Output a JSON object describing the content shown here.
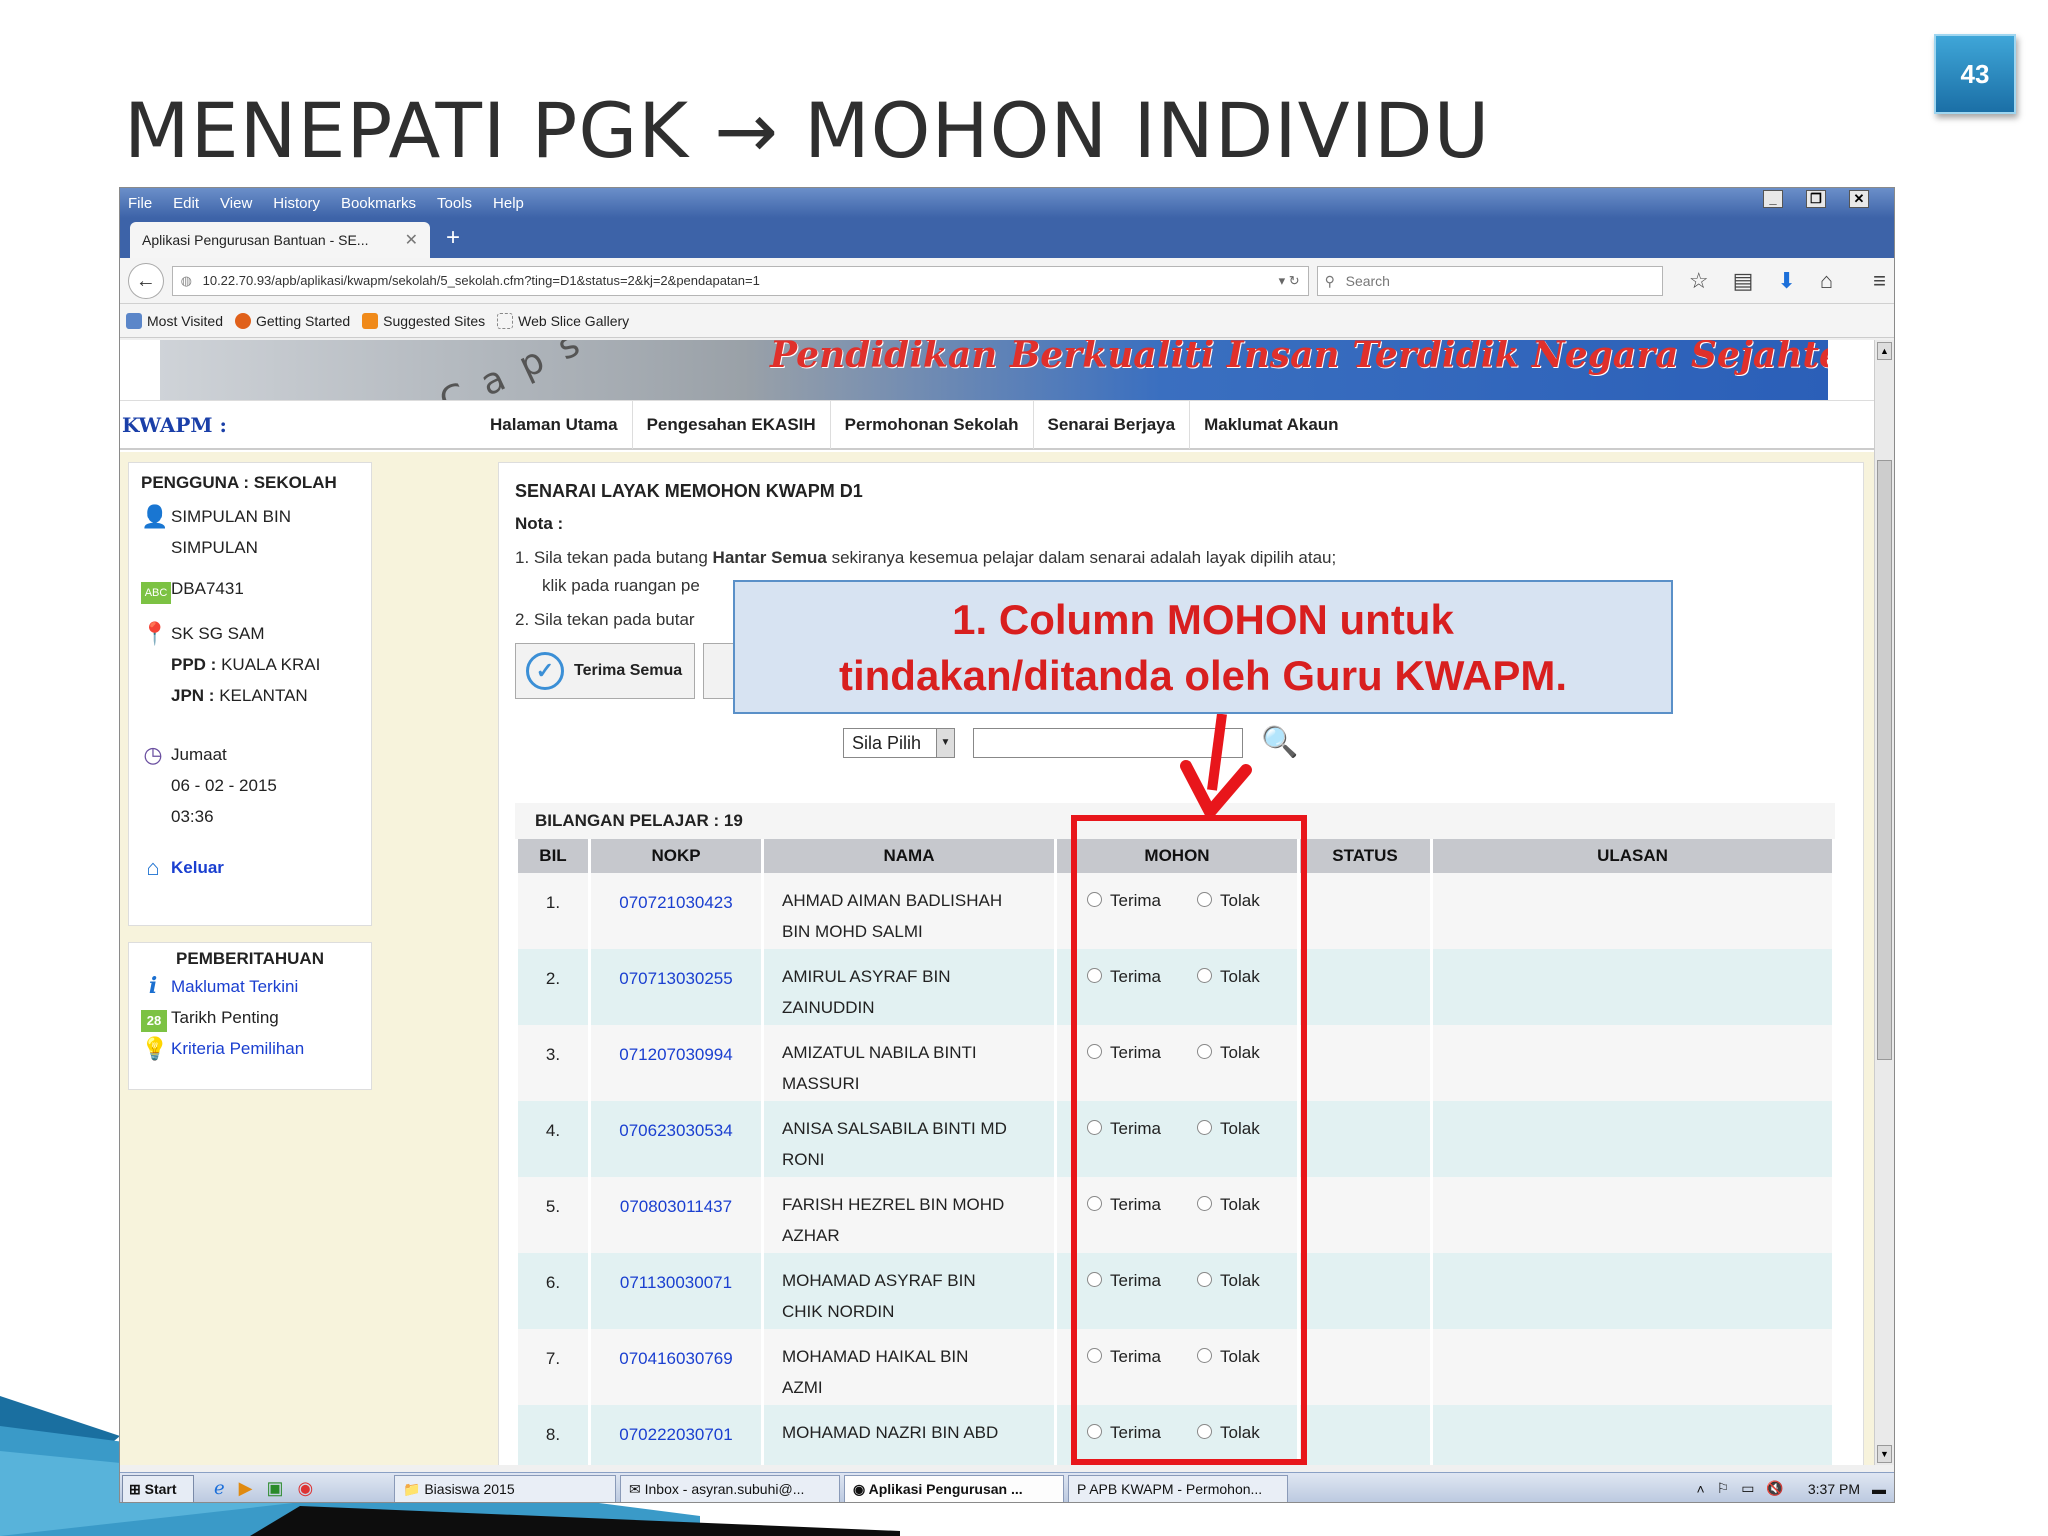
{
  "slide": {
    "title": "MENEPATI PGK → MOHON INDIVIDU",
    "page_number": "43"
  },
  "browser": {
    "menu": [
      "File",
      "Edit",
      "View",
      "History",
      "Bookmarks",
      "Tools",
      "Help"
    ],
    "tab_title": "Aplikasi Pengurusan Bantuan - SE...",
    "url": "10.22.70.93/apb/aplikasi/kwapm/sekolah/5_sekolah.cfm?ting=D1&status=2&kj=2&pendapatan=1",
    "search_placeholder": "Search",
    "bookmarks": [
      "Most Visited",
      "Getting Started",
      "Suggested Sites",
      "Web Slice Gallery"
    ]
  },
  "site": {
    "banner_motto": "Pendidikan Berkualiti Insan Terdidik Negara Sejahtera",
    "brand": "KWAPM :",
    "nav": [
      "Halaman Utama",
      "Pengesahan EKASIH",
      "Permohonan Sekolah",
      "Senarai Berjaya",
      "Maklumat Akaun"
    ]
  },
  "sidebar": {
    "user_heading": "PENGGUNA : SEKOLAH",
    "user_name_1": "SIMPULAN BIN",
    "user_name_2": "SIMPULAN",
    "code": "DBA7431",
    "school": "SK SG SAM",
    "ppd_label": "PPD :",
    "ppd": "KUALA KRAI",
    "jpn_label": "JPN :",
    "jpn": "KELANTAN",
    "day": "Jumaat",
    "date": "06 - 02 - 2015",
    "time": "03:36",
    "logout": "Keluar",
    "notice_heading": "PEMBERITAHUAN",
    "notices": [
      "Maklumat Terkini",
      "Tarikh Penting",
      "Kriteria Pemilihan"
    ],
    "calendar_day": "28"
  },
  "main": {
    "heading": "SENARAI LAYAK MEMOHON KWAPM D1",
    "nota": "Nota :",
    "note1_prefix": "1.  Sila tekan pada butang ",
    "note1_bold": "Hantar Semua",
    "note1_suffix": " sekiranya kesemua pelajar dalam senarai adalah layak dipilih atau;",
    "note1_line2": "klik pada ruangan pe",
    "note2": "2.  Sila tekan pada butar",
    "btn_terima_semua": "Terima Semua",
    "filter_select": "Sila Pilih",
    "count_label": "BILANGAN PELAJAR : 19",
    "columns": [
      "BIL",
      "NOKP",
      "NAMA",
      "MOHON",
      "STATUS",
      "ULASAN"
    ],
    "opt_terima": "Terima",
    "opt_tolak": "Tolak",
    "rows": [
      {
        "bil": "1.",
        "nokp": "070721030423",
        "nama1": "AHMAD AIMAN BADLISHAH",
        "nama2": "BIN MOHD SALMI"
      },
      {
        "bil": "2.",
        "nokp": "070713030255",
        "nama1": "AMIRUL ASYRAF BIN",
        "nama2": "ZAINUDDIN"
      },
      {
        "bil": "3.",
        "nokp": "071207030994",
        "nama1": "AMIZATUL NABILA BINTI",
        "nama2": "MASSURI"
      },
      {
        "bil": "4.",
        "nokp": "070623030534",
        "nama1": "ANISA SALSABILA BINTI MD",
        "nama2": "RONI"
      },
      {
        "bil": "5.",
        "nokp": "070803011437",
        "nama1": "FARISH HEZREL BIN MOHD",
        "nama2": "AZHAR"
      },
      {
        "bil": "6.",
        "nokp": "071130030071",
        "nama1": "MOHAMAD ASYRAF BIN",
        "nama2": "CHIK NORDIN"
      },
      {
        "bil": "7.",
        "nokp": "070416030769",
        "nama1": "MOHAMAD HAIKAL BIN",
        "nama2": "AZMI"
      },
      {
        "bil": "8.",
        "nokp": "070222030701",
        "nama1": "MOHAMAD NAZRI BIN ABD",
        "nama2": ""
      }
    ]
  },
  "callout": {
    "line1": "1. Column MOHON untuk",
    "line2": "tindakan/ditanda oleh Guru KWAPM."
  },
  "taskbar": {
    "start": "Start",
    "tasks": [
      "Biasiswa 2015",
      "Inbox - asyran.subuhi@...",
      "Aplikasi Pengurusan ...",
      "APB KWAPM - Permohon..."
    ],
    "clock": "3:37 PM"
  },
  "colors": {
    "callout_text": "#d81f1f",
    "highlight_box": "#e8161b",
    "row_alt": "#e2f1f2",
    "link": "#1a3fd0"
  }
}
